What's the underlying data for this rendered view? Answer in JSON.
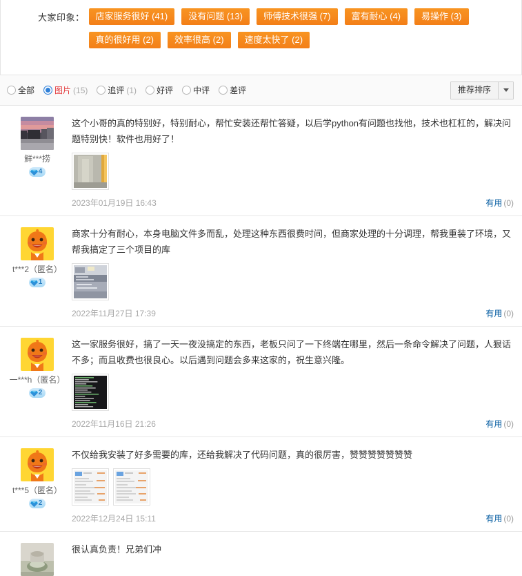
{
  "impression": {
    "label": "大家印象：",
    "tags": [
      {
        "text": "店家服务很好 (41)"
      },
      {
        "text": "没有问题 (13)"
      },
      {
        "text": "师傅技术很强 (7)"
      },
      {
        "text": "富有耐心 (4)"
      },
      {
        "text": "易操作 (3)"
      },
      {
        "text": "真的很好用 (2)"
      },
      {
        "text": "效率很高 (2)"
      },
      {
        "text": "速度太快了 (2)"
      }
    ]
  },
  "filter_bar": {
    "filters": [
      {
        "label": "全部",
        "count": "",
        "checked": false
      },
      {
        "label": "图片",
        "count": "(15)",
        "checked": true
      },
      {
        "label": "追评",
        "count": "(1)",
        "checked": false
      },
      {
        "label": "好评",
        "count": "",
        "checked": false
      },
      {
        "label": "中评",
        "count": "",
        "checked": false
      },
      {
        "label": "差评",
        "count": "",
        "checked": false
      }
    ],
    "sort_label": "推荐排序"
  },
  "reviews": [
    {
      "user": "鲜***捞",
      "level": "4",
      "avatar": "sunset-photo",
      "text": "这个小哥的真的特别好，特别耐心，帮忙安装还帮忙答疑，以后学python有问题也找他，技术也杠杠的，解决问题特别快！软件也用好了！",
      "thumbs": [
        "blurry-wall-photo"
      ],
      "date": "2023年01月19日 16:43",
      "useful_label": "有用",
      "useful_count": "(0)"
    },
    {
      "user": "t***2（匿名）",
      "level": "1",
      "avatar": "orange-cartoon-face",
      "text": "商家十分有耐心，本身电脑文件多而乱，处理这种东西很费时间，但商家处理的十分调理，帮我重装了环境，又帮我搞定了三个项目的库",
      "thumbs": [
        "screen-photo"
      ],
      "date": "2022年11月27日 17:39",
      "useful_label": "有用",
      "useful_count": "(0)"
    },
    {
      "user": "一***h（匿名）",
      "level": "2",
      "avatar": "orange-cartoon-face",
      "text": "这一家服务很好，搞了一天一夜没搞定的东西，老板只问了一下终端在哪里，然后一条命令解决了问题，人狠话不多；而且收费也很良心。以后遇到问题会多来这家的，祝生意兴隆。",
      "thumbs": [
        "terminal-screenshot"
      ],
      "date": "2022年11月16日 21:26",
      "useful_label": "有用",
      "useful_count": "(0)"
    },
    {
      "user": "t***5（匿名）",
      "level": "2",
      "avatar": "orange-cartoon-face",
      "text": "不仅给我安装了好多需要的库，还给我解决了代码问题，真的很厉害，赞赞赞赞赞赞赞",
      "thumbs": [
        "chat-screenshot",
        "chat-screenshot"
      ],
      "date": "2022年12月24日 15:11",
      "useful_label": "有用",
      "useful_count": "(0)"
    },
    {
      "user": "",
      "level": "",
      "avatar": "grey-object-photo",
      "text": "很认真负责！兄弟们冲",
      "thumbs": [],
      "date": "",
      "useful_label": "",
      "useful_count": ""
    }
  ]
}
